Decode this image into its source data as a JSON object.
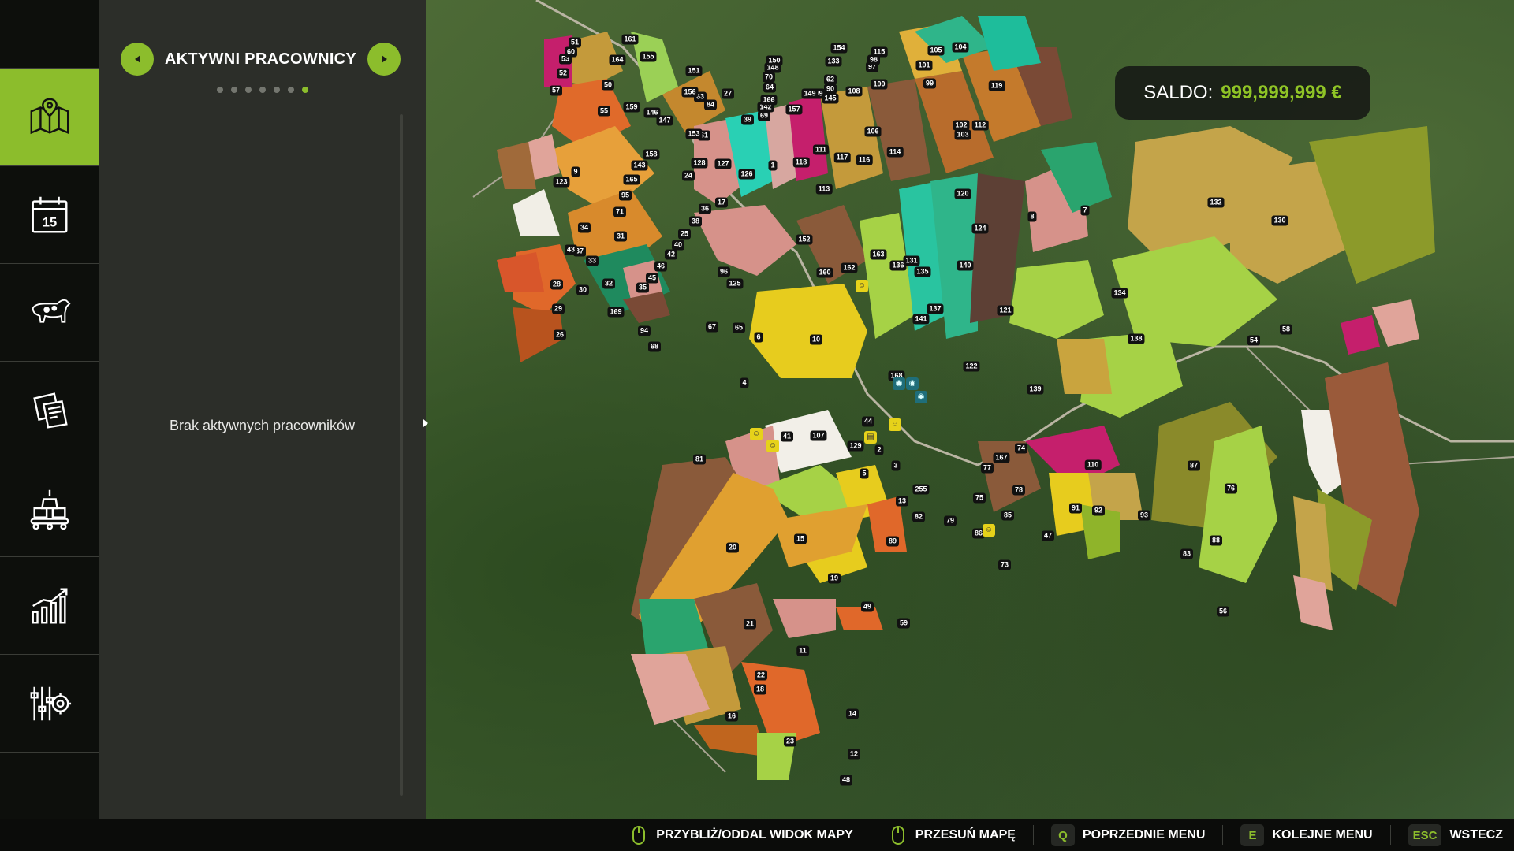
{
  "balance": {
    "label": "SALDO:",
    "value": "999,999,999 €"
  },
  "panel": {
    "title": "AKTYWNI PRACOWNICY",
    "empty_message": "Brak aktywnych pracowników",
    "page_count": 7,
    "active_page": 7
  },
  "nav": {
    "items": [
      {
        "name": "map",
        "icon": "map-pin-icon",
        "active": true
      },
      {
        "name": "calendar",
        "icon": "calendar-icon",
        "active": false,
        "badge": "15"
      },
      {
        "name": "animals",
        "icon": "cow-icon",
        "active": false
      },
      {
        "name": "contracts",
        "icon": "documents-icon",
        "active": false
      },
      {
        "name": "production",
        "icon": "factory-icon",
        "active": false
      },
      {
        "name": "statistics",
        "icon": "chart-icon",
        "active": false
      },
      {
        "name": "settings",
        "icon": "settings-gear-icon",
        "active": false
      }
    ]
  },
  "hints": [
    {
      "key": "",
      "icon": "mouse-icon",
      "label": "PRZYBLIŻ/ODDAL WIDOK MAPY"
    },
    {
      "key": "",
      "icon": "mouse-icon",
      "label": "PRZESUŃ MAPĘ"
    },
    {
      "key": "Q",
      "label": "POPRZEDNIE MENU"
    },
    {
      "key": "E",
      "label": "KOLEJNE MENU"
    },
    {
      "key": "ESC",
      "label": "WSTECZ"
    }
  ],
  "map": {
    "field_numbers": [
      "1",
      "2",
      "3",
      "4",
      "5",
      "6",
      "7",
      "8",
      "9",
      "10",
      "11",
      "12",
      "13",
      "14",
      "15",
      "16",
      "17",
      "18",
      "19",
      "20",
      "21",
      "22",
      "23",
      "24",
      "25",
      "26",
      "27",
      "28",
      "29",
      "30",
      "31",
      "32",
      "33",
      "34",
      "35",
      "36",
      "37",
      "38",
      "39",
      "40",
      "41",
      "42",
      "43",
      "44",
      "45",
      "46",
      "47",
      "48",
      "49",
      "50",
      "51",
      "52",
      "53",
      "54",
      "55",
      "56",
      "57",
      "58",
      "59",
      "60",
      "61",
      "62",
      "63",
      "64",
      "65",
      "67",
      "68",
      "69",
      "70",
      "71",
      "73",
      "74",
      "75",
      "76",
      "77",
      "78",
      "79",
      "81",
      "82",
      "83",
      "84",
      "85",
      "86",
      "87",
      "88",
      "89",
      "90",
      "91",
      "92",
      "93",
      "94",
      "95",
      "96",
      "97",
      "98",
      "99",
      "100",
      "101",
      "102",
      "103",
      "104",
      "105",
      "106",
      "107",
      "108",
      "109",
      "110",
      "111",
      "112",
      "113",
      "114",
      "115",
      "116",
      "117",
      "118",
      "119",
      "120",
      "121",
      "122",
      "123",
      "124",
      "125",
      "126",
      "127",
      "128",
      "129",
      "130",
      "131",
      "132",
      "133",
      "134",
      "135",
      "136",
      "137",
      "138",
      "139",
      "140",
      "141",
      "142",
      "143",
      "145",
      "146",
      "147",
      "148",
      "149",
      "150",
      "151",
      "152",
      "153",
      "154",
      "155",
      "156",
      "157",
      "158",
      "159",
      "160",
      "161",
      "162",
      "163",
      "164",
      "165",
      "166",
      "167",
      "168",
      "169",
      "255"
    ]
  }
}
